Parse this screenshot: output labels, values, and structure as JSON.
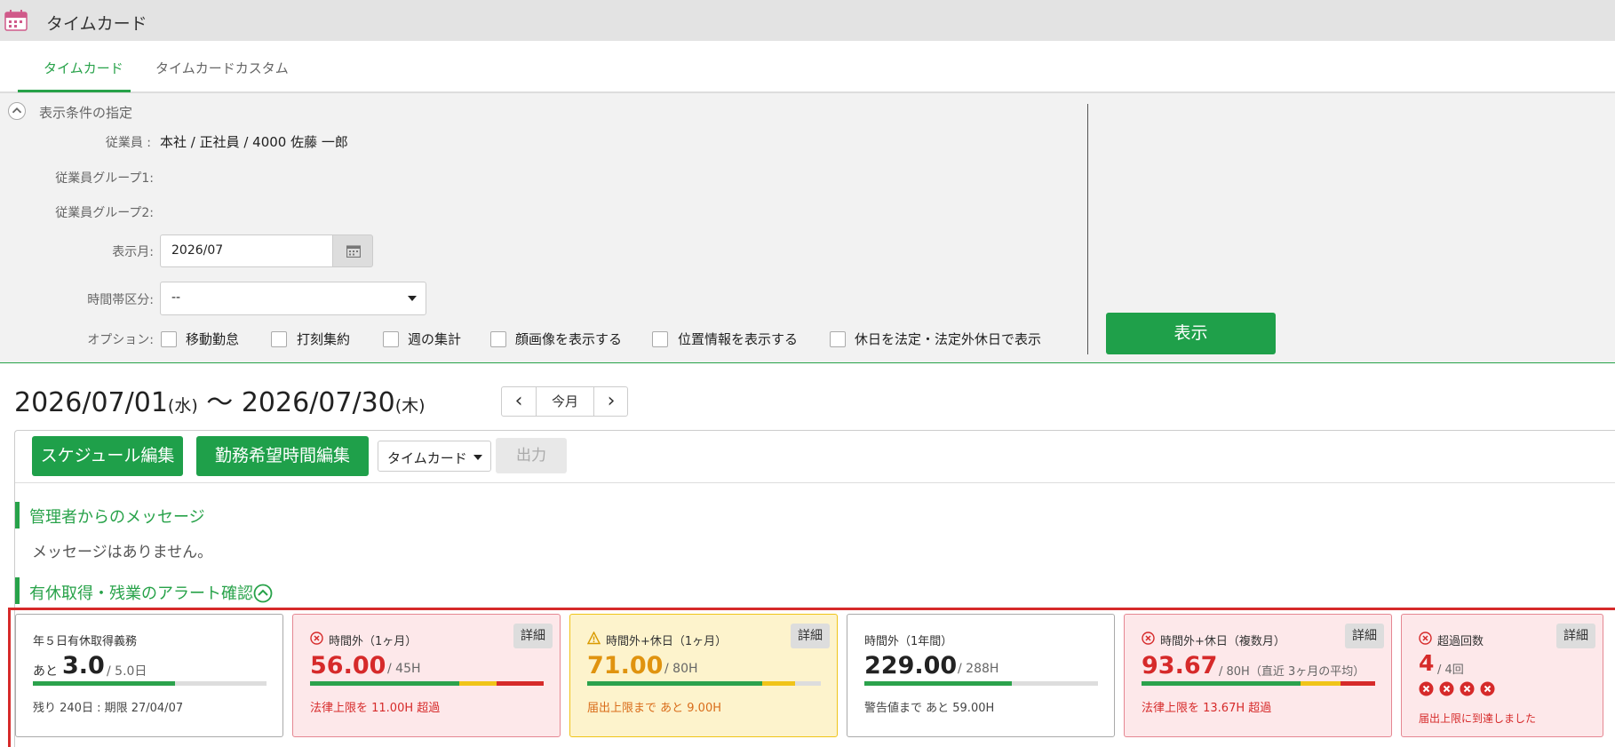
{
  "window": {
    "title": "タイムカード"
  },
  "tabs": [
    {
      "label": "タイムカード"
    },
    {
      "label": "タイムカードカスタム"
    }
  ],
  "conditions": {
    "title": "表示条件の指定",
    "employee_label": "従業員 :",
    "employee_value": "本社 / 正社員 / 4000 佐藤 一郎",
    "group1_label": "従業員グループ1:",
    "group2_label": "従業員グループ2:",
    "month_label": "表示月:",
    "month_value": "2026/07",
    "timezone_label": "時間帯区分:",
    "timezone_value": "--",
    "options_label": "オプション:",
    "options": [
      "移動勤怠",
      "打刻集約",
      "週の集計",
      "顔画像を表示する",
      "位置情報を表示する",
      "休日を法定・法定外休日で表示"
    ],
    "show_button": "表示"
  },
  "range": {
    "start": "2026/07/01",
    "start_dow": "(水)",
    "tilde": "〜",
    "end": "2026/07/30",
    "end_dow": "(木)",
    "prev": "‹",
    "today": "今月",
    "next": "›"
  },
  "toolbar": {
    "schedule_edit": "スケジュール編集",
    "hope_edit": "勤務希望時間編集",
    "select_value": "タイムカード",
    "output": "出力"
  },
  "messages": {
    "title": "管理者からのメッセージ",
    "empty": "メッセージはありません。"
  },
  "alerts": {
    "title": "有休取得・残業のアラート確認",
    "detail_label": "詳細",
    "cards": [
      {
        "title": "年５日有休取得義務",
        "prefix": "あと",
        "value": "3.0",
        "limit": "/ 5.0日",
        "foot": "残り 240日 : 期限 27/04/07",
        "fill": 0.6,
        "status": "normal"
      },
      {
        "title": "時間外（1ヶ月）",
        "value": "56.00",
        "limit": "/ 45H",
        "foot": "法律上限を 11.00H 超過",
        "fill": 1.0,
        "status": "red"
      },
      {
        "title": "時間外+休日（1ヶ月）",
        "value": "71.00",
        "limit": "/ 80H",
        "foot": "届出上限まで あと 9.00H",
        "fill": 0.89,
        "status": "yellow"
      },
      {
        "title": "時間外（1年間）",
        "value": "229.00",
        "limit": "/ 288H",
        "foot": "警告値まで あと 59.00H",
        "fill": 0.63,
        "status": "normal"
      },
      {
        "title": "時間外+休日（複数月）",
        "value": "93.67",
        "limit": "/ 80H（直近 3ヶ月の平均）",
        "foot": "法律上限を 13.67H 超過",
        "fill": 1.0,
        "status": "red"
      },
      {
        "title": "超過回数",
        "value": "4",
        "limit": "/ 4回",
        "foot": "届出上限に到達しました",
        "count": 4,
        "status": "red"
      }
    ]
  },
  "colors": {
    "accent": "#1fa04a",
    "danger": "#d62a2a",
    "warning": "#f0c419",
    "bar_green": "#2ba24c"
  }
}
